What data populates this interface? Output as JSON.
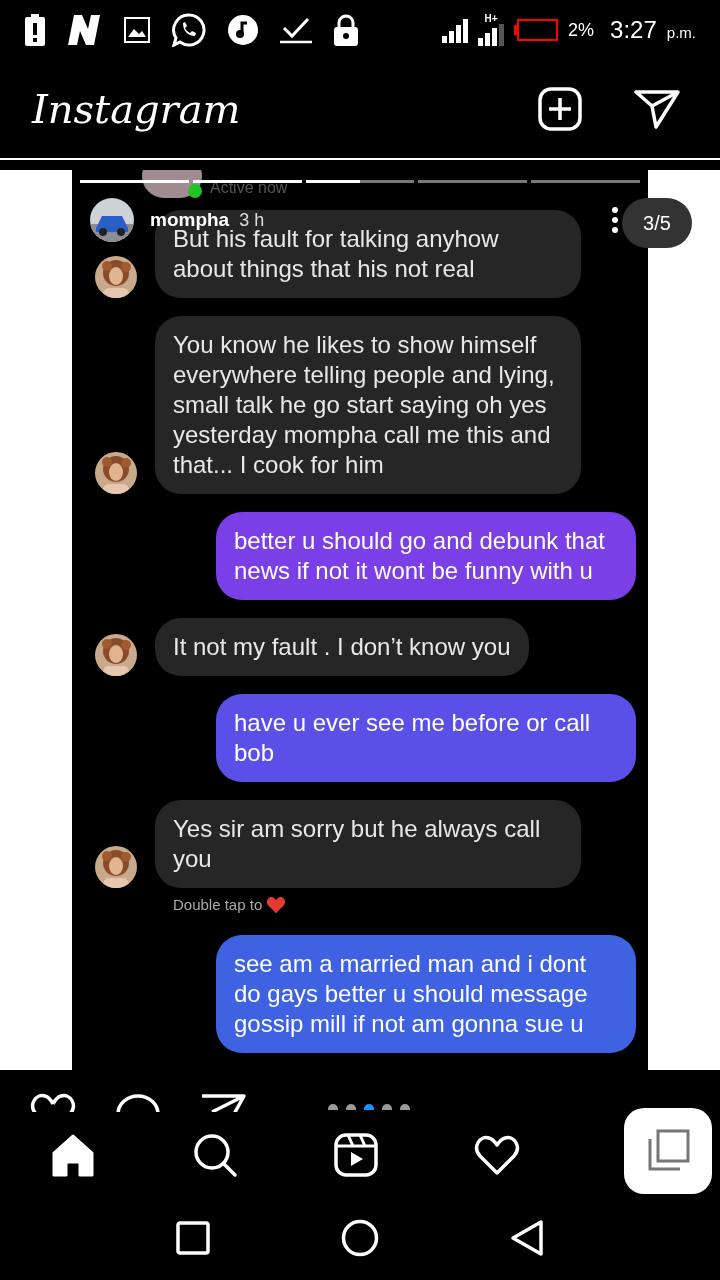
{
  "status_bar": {
    "battery": "2%",
    "time": "3:27",
    "period": "p.m.",
    "network": "H+"
  },
  "header": {
    "title": "Instagram"
  },
  "story": {
    "username": "mompha",
    "age": "3 h",
    "counter": "3/5",
    "progress": [
      {
        "level": 1
      },
      {
        "level": 1
      },
      {
        "level": 0.5
      },
      {
        "level": 0
      },
      {
        "level": 0
      }
    ],
    "screenshot": {
      "status": "Active now",
      "messages": [
        {
          "kind": "received",
          "text": "But his fault for talking anyhow about things that his not real"
        },
        {
          "kind": "received",
          "text": "You know he likes to show himself everywhere telling people and lying, small talk he go start saying oh yes yesterday mompha call me this and that... I cook for him"
        },
        {
          "kind": "sent",
          "text": "better u should go and debunk that news if not it wont be funny with u"
        },
        {
          "kind": "received",
          "text": "It not my fault . I don’t know you"
        },
        {
          "kind": "sent",
          "text": "have u ever see me before or call bob"
        },
        {
          "kind": "received",
          "text": "Yes sir am sorry but he always call you",
          "hint": "Double tap to"
        },
        {
          "kind": "sent",
          "text": "see am a married man and i dont do gays better u should message gossip mill if not am gonna sue u"
        }
      ]
    }
  },
  "carousel_dots": [
    {
      "selected": false
    },
    {
      "selected": false
    },
    {
      "selected": true
    },
    {
      "selected": false
    },
    {
      "selected": false
    }
  ],
  "bottom_nav": [
    {
      "kind": "home",
      "selected": true
    },
    {
      "kind": "search",
      "selected": false
    },
    {
      "kind": "reels",
      "selected": false
    },
    {
      "kind": "activity",
      "selected": false
    }
  ]
}
